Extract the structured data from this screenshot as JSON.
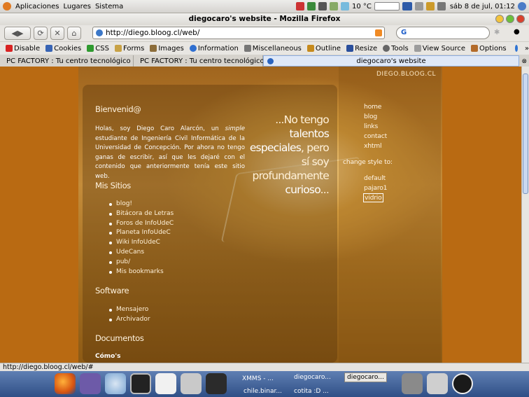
{
  "system": {
    "menus": [
      "Aplicaciones",
      "Lugares",
      "Sistema"
    ],
    "temp": "10 °C",
    "datetime": "sáb  8 de jul, 01:12"
  },
  "window": {
    "title": "diegocaro's website - Mozilla Firefox"
  },
  "navbar": {
    "url": "http://diego.bloog.cl/web/",
    "search_glyph": "G"
  },
  "devbar": {
    "items": [
      "Disable",
      "Cookies",
      "CSS",
      "Forms",
      "Images",
      "Information",
      "Miscellaneous",
      "Outline",
      "Resize",
      "Tools",
      "View Source",
      "Options"
    ]
  },
  "tabs": [
    "PC FACTORY : Tu centro tecnológico",
    "PC FACTORY : Tu centro tecnológico",
    "diegocaro's website"
  ],
  "page": {
    "site_name": "DIEGO.BLOOG.CL",
    "welcome_title": "Bienvenid@",
    "intro_before": "Holas, soy Diego Caro Alarcón, un ",
    "intro_em": "simple",
    "intro_after": " estudiante de Ingeniería Civil Informática de la Universidad de Concepción. Por ahora no tengo ganas de escribir, así que les dejaré con el contenido que anteriormente tenía este sitio web.",
    "sites_title": "Mis Sitios",
    "sites": [
      "blog!",
      "Bitácora de Letras",
      "Foros de InfoUdeC",
      "Planeta InfoUdeC",
      "Wiki InfoUdeC",
      "UdeCans",
      "pub/",
      "Mis bookmarks"
    ],
    "software_title": "Software",
    "software": [
      "Mensajero",
      "Archivador"
    ],
    "docs_title": "Documentos",
    "docs_sub": "Cómo's",
    "quote_1": "...No tengo",
    "quote_2": "talentos",
    "quote_3": "especiales",
    "quote_4": ", pero",
    "quote_5": "sí soy",
    "quote_6": "profundamente",
    "quote_7": "curioso",
    "quote_8": "...",
    "nav": [
      "home",
      "blog",
      "links",
      "contact",
      "xhtml"
    ],
    "style_label": "change style to:",
    "styles": [
      "default",
      "pajaro1",
      "vidrio"
    ]
  },
  "status": {
    "text": "http://diego.bloog.cl/web/#"
  },
  "taskbar": {
    "tasks": [
      "XMMS - ...",
      "diegocaro...",
      "diegocaro...",
      "chile.binar...",
      "cotita :D ..."
    ]
  }
}
